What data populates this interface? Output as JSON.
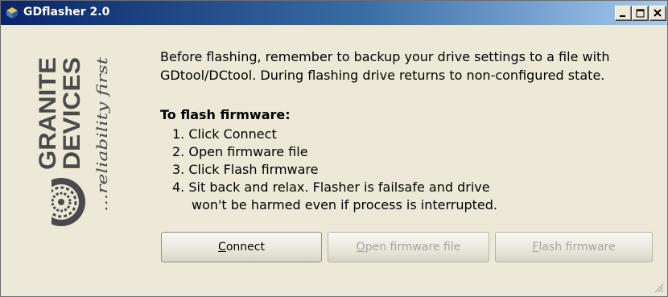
{
  "window": {
    "title": "GDflasher 2.0",
    "controls": {
      "minimize": "minimize-icon",
      "maximize": "maximize-icon",
      "close": "close-icon"
    }
  },
  "logo": {
    "brand_line1": "GRANITE",
    "brand_line2": "DEVICES",
    "tagline": "...reliability first"
  },
  "intro": {
    "line1": "Before flashing, remember to backup your drive settings to a file with",
    "line2": "GDtool/DCtool. During flashing drive returns to non-configured state."
  },
  "instructions": {
    "title": "To flash firmware:",
    "steps": [
      "1. Click Connect",
      "2. Open firmware file",
      "3. Click Flash firmware",
      "4. Sit back and relax. Flasher is failsafe and drive",
      "won't be harmed even if process is interrupted."
    ]
  },
  "buttons": {
    "connect": {
      "mnemonic": "C",
      "rest": "onnect",
      "enabled": true
    },
    "open_firmware": {
      "mnemonic": "O",
      "rest": "pen firmware file",
      "enabled": false
    },
    "flash_firmware": {
      "mnemonic": "F",
      "rest": "lash firmware",
      "enabled": false
    }
  },
  "colors": {
    "title_gradient_start": "#0a246a",
    "title_gradient_end": "#a6caf0",
    "window_bg": "#ece9d8",
    "disabled_text": "#a3a3a3"
  }
}
